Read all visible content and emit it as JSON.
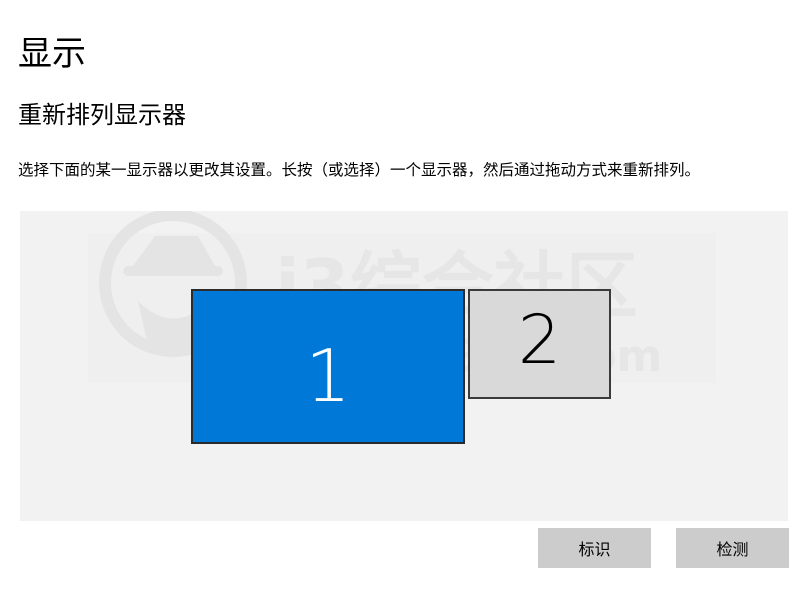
{
  "page": {
    "title": "显示"
  },
  "arrange": {
    "heading": "重新排列显示器",
    "description": "选择下面的某一显示器以更改其设置。长按（或选择）一个显示器，然后通过拖动方式来重新排列。",
    "monitors": [
      {
        "number": "1",
        "selected": true,
        "color": "#0078d7"
      },
      {
        "number": "2",
        "selected": false,
        "color": "#d9d9d9"
      }
    ],
    "watermark": {
      "brand": "i3综合社区",
      "url": "www.i3zh.com"
    }
  },
  "actions": {
    "identify_label": "标识",
    "detect_label": "检测"
  },
  "colors": {
    "accent": "#0078d7",
    "canvas_bg": "#f2f2f2",
    "button_bg": "#cccccc"
  }
}
